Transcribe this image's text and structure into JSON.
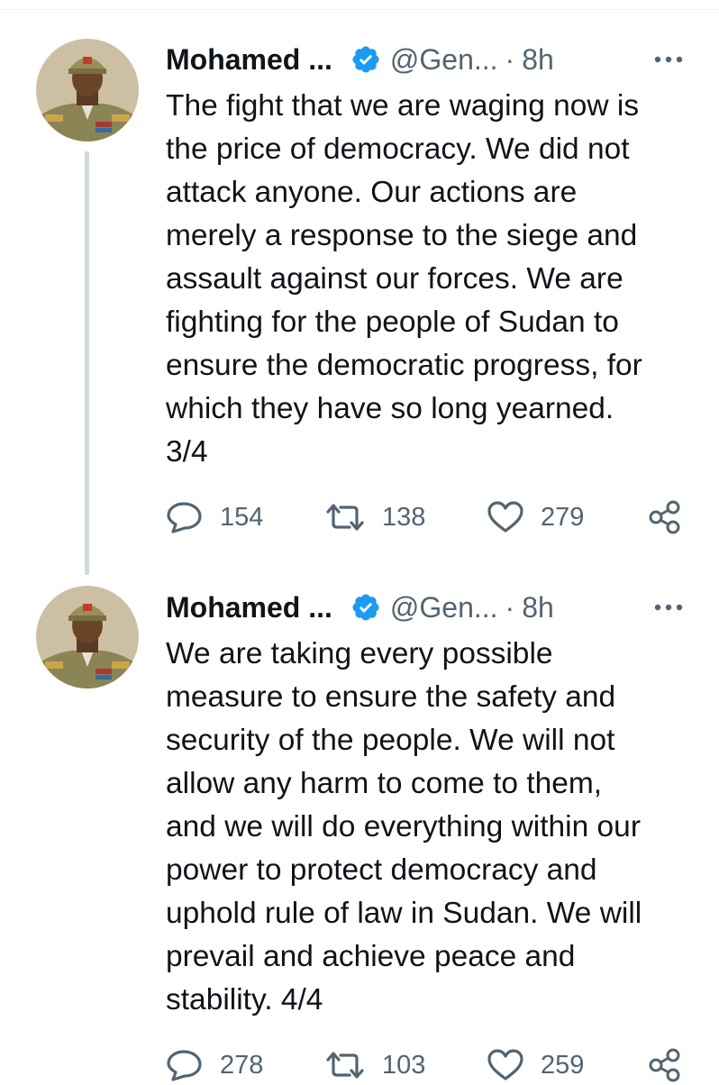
{
  "tweets": [
    {
      "author_name": "Mohamed ...",
      "handle": "@Gen...",
      "separator": "·",
      "time": "8h",
      "text": "The fight that we are waging now is\nthe price of democracy. We did not\nattack anyone. Our actions are\nmerely a response to the siege and\nassault against our forces. We are\nfighting for the people of Sudan to\nensure the democratic progress, for\nwhich they have so long yearned.\n3/4",
      "replies": "154",
      "retweets": "138",
      "likes": "279"
    },
    {
      "author_name": "Mohamed ...",
      "handle": "@Gen...",
      "separator": "·",
      "time": "8h",
      "text": "We are taking every possible\nmeasure to ensure the safety and\nsecurity of the people. We will not\nallow any harm to come to them,\nand we will do everything within our\npower to protect democracy and\nuphold rule of law in Sudan. We will\nprevail and achieve peace and\nstability. 4/4",
      "replies": "278",
      "retweets": "103",
      "likes": "259"
    }
  ],
  "icons": {
    "verified": "verified-badge-icon",
    "more": "more-dots-icon",
    "reply": "reply-bubble-icon",
    "retweet": "retweet-arrows-icon",
    "like": "heart-icon",
    "share": "share-nodes-icon"
  },
  "colors": {
    "text": "#0f1419",
    "secondary": "#536471",
    "verified": "#1d9bf0",
    "thread_line": "#cfd9de"
  }
}
